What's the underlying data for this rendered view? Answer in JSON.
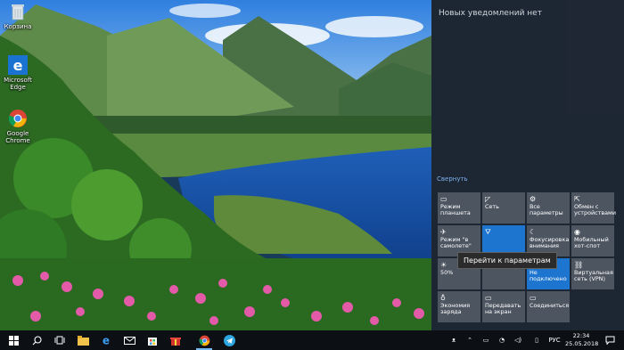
{
  "desktop": {
    "icons": [
      {
        "name": "recycle-bin",
        "label": "Корзина"
      },
      {
        "name": "microsoft-edge",
        "label": "Microsoft Edge"
      },
      {
        "name": "google-chrome",
        "label": "Google Chrome"
      }
    ]
  },
  "action_center": {
    "header": "Новых уведомлений нет",
    "collapse_label": "Свернуть",
    "tiles": [
      {
        "label": "Режим планшета",
        "icon": "tablet-icon",
        "active": false
      },
      {
        "label": "Сеть",
        "icon": "network-icon",
        "active": false
      },
      {
        "label": "Все параметры",
        "icon": "gear-icon",
        "active": false
      },
      {
        "label": "Обмен с устройствами",
        "icon": "share-icon",
        "active": false
      },
      {
        "label": "Режим \"в самолете\"",
        "icon": "airplane-icon",
        "active": false
      },
      {
        "label": "",
        "icon": "location-icon",
        "active": true
      },
      {
        "label": "Фокусировка внимания",
        "icon": "moon-icon",
        "active": false
      },
      {
        "label": "Мобильный хот-спот",
        "icon": "hotspot-icon",
        "active": false
      },
      {
        "label": "50%",
        "icon": "brightness-icon",
        "active": false
      },
      {
        "label": "",
        "icon": "",
        "active": false
      },
      {
        "label": "Не подключено",
        "icon": "bluetooth-icon",
        "active": true
      },
      {
        "label": "Виртуальная сеть (VPN)",
        "icon": "vpn-icon",
        "active": false
      },
      {
        "label": "Экономия заряда",
        "icon": "battery-saver-icon",
        "active": false
      },
      {
        "label": "Передавать на экран",
        "icon": "project-icon",
        "active": false
      },
      {
        "label": "Соединиться",
        "icon": "connect-icon",
        "active": false
      }
    ],
    "tooltip": "Перейти к параметрам"
  },
  "taskbar": {
    "language": "РУС",
    "time": "22:34",
    "date": "25.05.2018"
  },
  "colors": {
    "accent": "#1e75d0",
    "tile_bg": "#4d5561",
    "panel_bg": "#1e2632",
    "taskbar_bg": "#0c0f14"
  }
}
